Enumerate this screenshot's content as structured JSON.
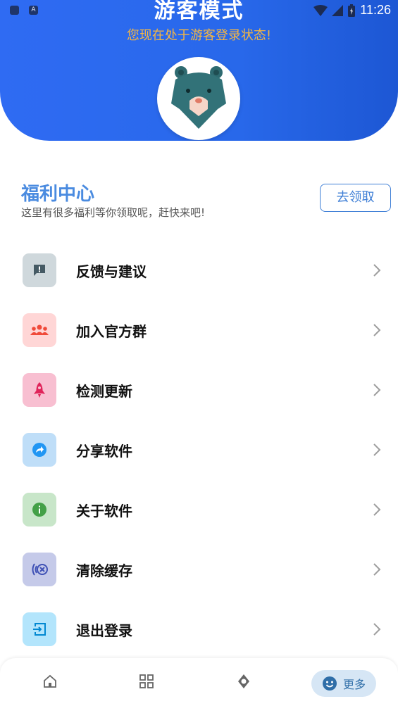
{
  "status_bar": {
    "time": "11:26",
    "left_icons": [
      "sim-icon",
      "a-icon"
    ],
    "a_label": "A"
  },
  "header": {
    "title": "游客模式",
    "subtitle": "您现在处于游客登录状态!"
  },
  "welfare": {
    "title": "福利中心",
    "description": "这里有很多福利等你领取呢，赶快来吧!",
    "button_label": "去领取"
  },
  "menu": [
    {
      "label": "反馈与建议",
      "icon": "feedback-icon",
      "icon_bg": "#cfd8dc",
      "icon_color": "#455a64"
    },
    {
      "label": "加入官方群",
      "icon": "group-icon",
      "icon_bg": "#ffd6d6",
      "icon_color": "#f04a3a"
    },
    {
      "label": "检测更新",
      "icon": "rocket-icon",
      "icon_bg": "#f8bfd1",
      "icon_color": "#e0235a"
    },
    {
      "label": "分享软件",
      "icon": "share-icon",
      "icon_bg": "#bfdef8",
      "icon_color": "#2196f3"
    },
    {
      "label": "关于软件",
      "icon": "info-icon",
      "icon_bg": "#c8e6c9",
      "icon_color": "#43a047"
    },
    {
      "label": "清除缓存",
      "icon": "clear-cache-icon",
      "icon_bg": "#c5cae9",
      "icon_color": "#3f51b5"
    },
    {
      "label": "退出登录",
      "icon": "logout-icon",
      "icon_bg": "#b3e5fc",
      "icon_color": "#0288d1"
    }
  ],
  "bottom_nav": {
    "items": [
      {
        "name": "home",
        "icon": "home-icon"
      },
      {
        "name": "apps",
        "icon": "grid-icon"
      },
      {
        "name": "discover",
        "icon": "compass-icon"
      },
      {
        "name": "more",
        "icon": "smile-icon",
        "label": "更多",
        "active": true
      }
    ]
  },
  "colors": {
    "header": "#2868ea",
    "subtitle": "#f5b642",
    "welfare_title": "#4a8be0",
    "accent": "#3f7fd6"
  }
}
